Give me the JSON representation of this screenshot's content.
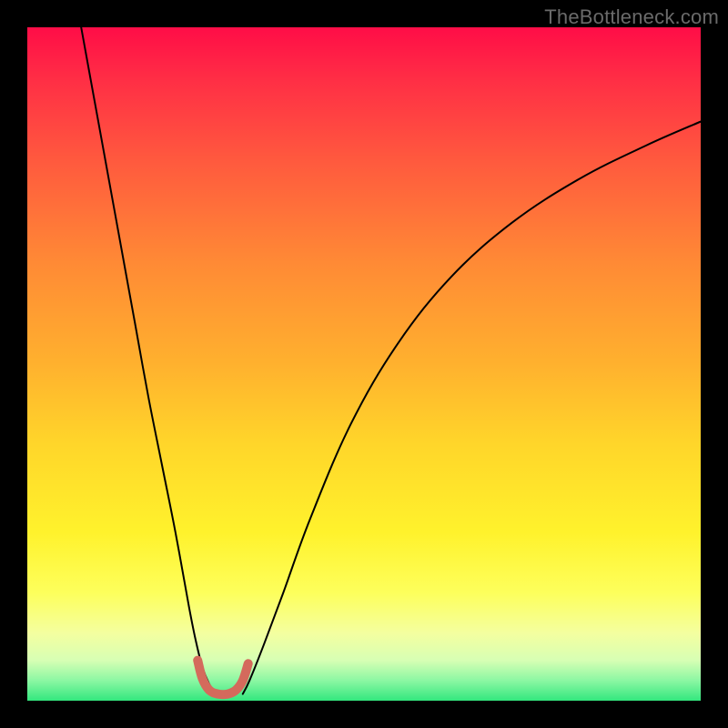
{
  "watermark": "TheBottleneck.com",
  "chart_data": {
    "type": "line",
    "title": "",
    "xlabel": "",
    "ylabel": "",
    "xlim": [
      0,
      100
    ],
    "ylim": [
      0,
      100
    ],
    "series": [
      {
        "name": "left-branch",
        "x": [
          8,
          10,
          12,
          14,
          16,
          18,
          20,
          22,
          24,
          25,
          26,
          27,
          28
        ],
        "y": [
          100,
          89,
          78,
          67,
          56,
          45,
          35,
          25,
          14,
          9,
          5,
          2.5,
          1
        ],
        "color": "#000000",
        "width": 2
      },
      {
        "name": "right-branch",
        "x": [
          32,
          33,
          35,
          38,
          42,
          48,
          55,
          63,
          72,
          82,
          92,
          100
        ],
        "y": [
          1,
          3,
          8,
          16,
          27,
          41,
          53,
          63,
          71,
          77.5,
          82.5,
          86
        ],
        "color": "#000000",
        "width": 2
      },
      {
        "name": "valley-marker",
        "x": [
          25.3,
          26.0,
          27.0,
          28.3,
          29.8,
          31.0,
          32.0,
          32.8
        ],
        "y": [
          6.0,
          3.3,
          1.6,
          1.0,
          1.0,
          1.6,
          3.0,
          5.5
        ],
        "color": "#d46a5c",
        "width": 10
      }
    ],
    "annotations": [
      {
        "text": "TheBottleneck.com",
        "position": "top-right"
      }
    ]
  }
}
